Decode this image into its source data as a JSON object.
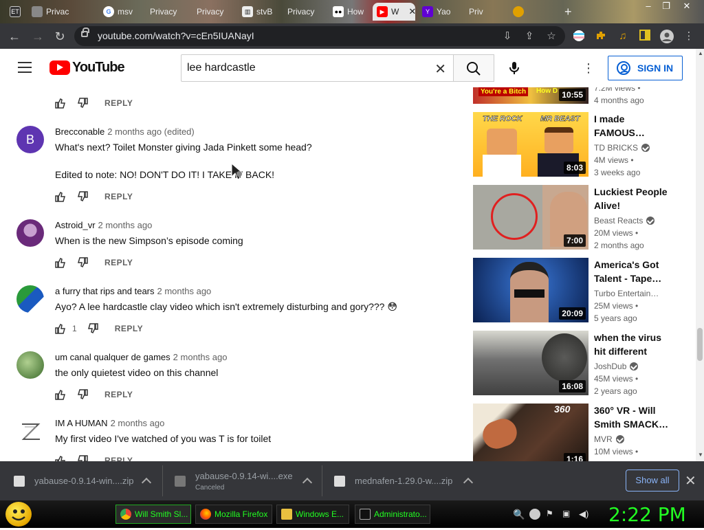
{
  "browser": {
    "tabs": [
      {
        "label": "",
        "icon": "et-icon"
      },
      {
        "label": "Privac",
        "icon": "tab-icon"
      },
      {
        "label": "msv",
        "icon": "google-icon"
      },
      {
        "label": "Privacy",
        "icon": "tab-icon"
      },
      {
        "label": "Privacy",
        "icon": "tab-icon"
      },
      {
        "label": "stvB",
        "icon": "bank-icon"
      },
      {
        "label": "Privacy",
        "icon": "tab-icon"
      },
      {
        "label": "How",
        "icon": "medium-icon"
      },
      {
        "label": "W",
        "icon": "youtube-icon"
      },
      {
        "label": "Yao",
        "icon": "yahoo-icon"
      },
      {
        "label": "Priv",
        "icon": "tab-icon"
      },
      {
        "label": "",
        "icon": "tab-icon"
      }
    ],
    "url": "youtube.com/watch?v=cEn5IUANayI",
    "et_label": "ET"
  },
  "youtube": {
    "logo_text": "YouTube",
    "search_value": "lee hardcastle",
    "signin_label": "SIGN IN"
  },
  "comments": [
    {
      "kind": "actions-only",
      "reply": "REPLY"
    },
    {
      "author": "Brecconable",
      "time": "2 months ago (edited)",
      "lines": [
        "What's next? Toilet Monster giving Jada Pinkett some head?",
        "Edited to note: NO! DON'T DO IT! I TAKE IT BACK!"
      ],
      "avatar_letter": "B",
      "avatar_color": "#5e35b1",
      "reply": "REPLY"
    },
    {
      "author": "Astroid_vr",
      "time": "2 months ago",
      "lines": [
        "When is the new Simpson’s episode coming"
      ],
      "reply": "REPLY"
    },
    {
      "author": "a furry that rips and tears",
      "time": "2 months ago",
      "lines": [
        "Ayo? A lee hardcastle clay video which isn't extremely disturbing and gory??? 😳"
      ],
      "likes": "1",
      "reply": "REPLY"
    },
    {
      "author": "um canal qualquer de games",
      "time": "2 months ago",
      "lines": [
        "the only quietest video on this channel"
      ],
      "reply": "REPLY"
    },
    {
      "author": "IM A HUMAN",
      "time": "2 months ago",
      "lines": [
        "My first video I've watched of you was T is for toilet"
      ],
      "reply": "REPLY"
    }
  ],
  "related": [
    {
      "title": "",
      "channel": "",
      "views": "7.2M views •",
      "age": "4 months ago",
      "duration": "10:55",
      "thumb_text_1": "You're a Bitch",
      "thumb_text_2": "How D"
    },
    {
      "title": "I made FAMOUS…",
      "channel": "TD BRICKS",
      "verified": true,
      "views": "4M views •",
      "age": "3 weeks ago",
      "duration": "8:03",
      "thumb_text_1": "THE ROCK",
      "thumb_text_2": "MR BEAST"
    },
    {
      "title": "Luckiest People Alive!",
      "channel": "Beast Reacts",
      "verified": true,
      "views": "20M views •",
      "age": "2 months ago",
      "duration": "7:00"
    },
    {
      "title": "America's Got Talent - Tape…",
      "channel": "Turbo Entertain…",
      "verified": false,
      "views": "25M views •",
      "age": "5 years ago",
      "duration": "20:09"
    },
    {
      "title": "when the virus hit different",
      "channel": "JoshDub",
      "verified": true,
      "views": "45M views •",
      "age": "2 years ago",
      "duration": "16:08"
    },
    {
      "title": "360° VR - Will Smith SMACK…",
      "channel": "MVR",
      "verified": true,
      "views": "10M views •",
      "age": "",
      "duration": "1:16",
      "thumb_text_1": "360"
    }
  ],
  "downloads": {
    "items": [
      {
        "name": "yabause-0.9.14-win....zip",
        "status": ""
      },
      {
        "name": "yabause-0.9.14-wi....exe",
        "status": "Canceled"
      },
      {
        "name": "mednafen-1.29.0-w....zip",
        "status": ""
      }
    ],
    "show_all": "Show all"
  },
  "taskbar": {
    "buttons": [
      {
        "label": "Will Smith Sl...",
        "active": true
      },
      {
        "label": "Mozilla Firefox",
        "active": false
      },
      {
        "label": "Windows E...",
        "active": false
      },
      {
        "label": "Administrato...",
        "active": false
      }
    ],
    "clock": "2:22 PM"
  }
}
